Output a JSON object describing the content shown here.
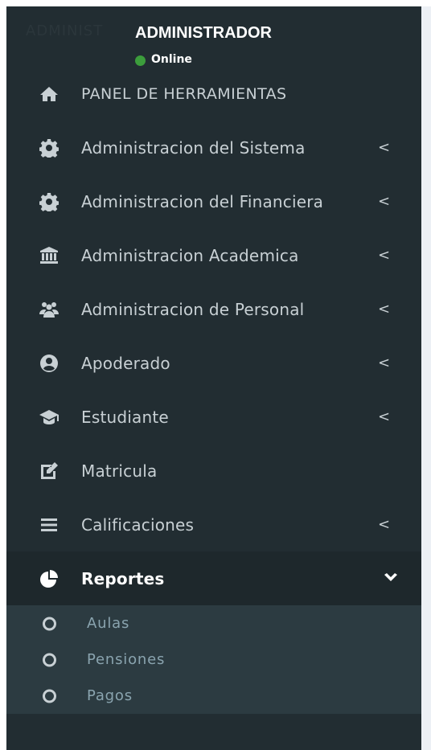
{
  "user": {
    "ghost_text": "ADMINIST",
    "name": "ADMINISTRADOR",
    "status": "Online",
    "status_color": "#3c9d3c"
  },
  "menu": [
    {
      "label": "PANEL DE HERRAMIENTAS",
      "icon": "home-icon",
      "chevron": ""
    },
    {
      "label": "Administracion del Sistema",
      "icon": "gear-icon",
      "chevron": "<"
    },
    {
      "label": "Administracion del Financiera",
      "icon": "gear-icon",
      "chevron": "<"
    },
    {
      "label": "Administracion Academica",
      "icon": "bank-icon",
      "chevron": "<"
    },
    {
      "label": "Administracion de Personal",
      "icon": "users-icon",
      "chevron": "<"
    },
    {
      "label": "Apoderado",
      "icon": "user-circle-icon",
      "chevron": "<"
    },
    {
      "label": "Estudiante",
      "icon": "graduation-cap-icon",
      "chevron": "<"
    },
    {
      "label": "Matricula",
      "icon": "edit-icon",
      "chevron": ""
    },
    {
      "label": "Calificaciones",
      "icon": "list-icon",
      "chevron": "<"
    },
    {
      "label": "Reportes",
      "icon": "pie-chart-icon",
      "chevron": "chevron-down-icon"
    }
  ],
  "submenu": [
    {
      "label": "Aulas",
      "icon": "circle-icon"
    },
    {
      "label": "Pensiones",
      "icon": "circle-icon"
    },
    {
      "label": "Pagos",
      "icon": "circle-icon"
    }
  ],
  "colors": {
    "sidebar_bg": "#222d32",
    "active_bg": "#1e282c",
    "submenu_bg": "#2c3b41",
    "text": "#c8d0d4"
  }
}
